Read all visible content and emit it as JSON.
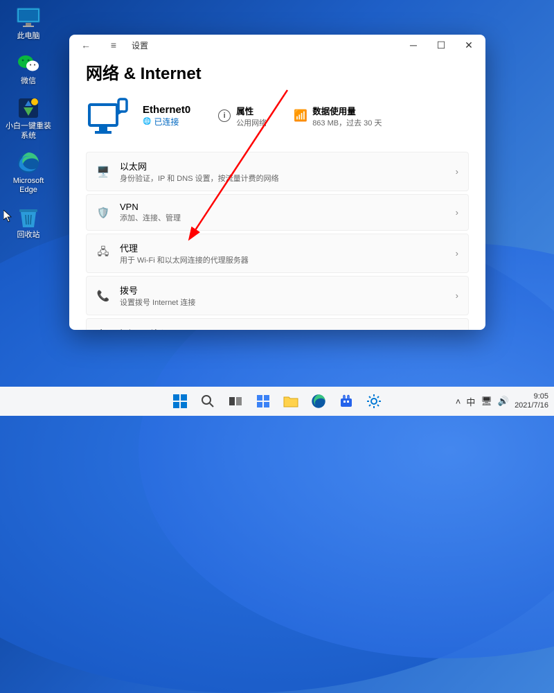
{
  "desktop": {
    "icons": [
      {
        "name": "this-pc",
        "label": "此电脑"
      },
      {
        "name": "wechat",
        "label": "微信"
      },
      {
        "name": "installer",
        "label": "小白一键重装系统"
      },
      {
        "name": "edge",
        "label": "Microsoft Edge"
      },
      {
        "name": "recycle",
        "label": "回收站"
      }
    ]
  },
  "window": {
    "title": "设置",
    "page_title": "网络 & Internet",
    "connection": {
      "name": "Ethernet0",
      "status": "已连接"
    },
    "properties": {
      "label": "属性",
      "sub": "公用网络"
    },
    "data_usage": {
      "label": "数据使用量",
      "sub": "863 MB，过去 30 天"
    },
    "rows": [
      {
        "icon": "ethernet-icon",
        "title": "以太网",
        "sub": "身份验证，IP 和 DNS 设置，按流量计费的网络"
      },
      {
        "icon": "vpn-icon",
        "title": "VPN",
        "sub": "添加、连接、管理"
      },
      {
        "icon": "proxy-icon",
        "title": "代理",
        "sub": "用于 Wi-Fi 和以太网连接的代理服务器"
      },
      {
        "icon": "dialup-icon",
        "title": "拨号",
        "sub": "设置拨号 Internet 连接"
      }
    ],
    "overflow_row": {
      "title": "高级网络设置"
    }
  },
  "taskbar": {
    "items": [
      "start",
      "search",
      "taskview",
      "widgets",
      "explorer",
      "edge",
      "store",
      "settings"
    ],
    "tray": {
      "lang": "中",
      "time": "9:05",
      "date": "2021/7/16"
    }
  }
}
